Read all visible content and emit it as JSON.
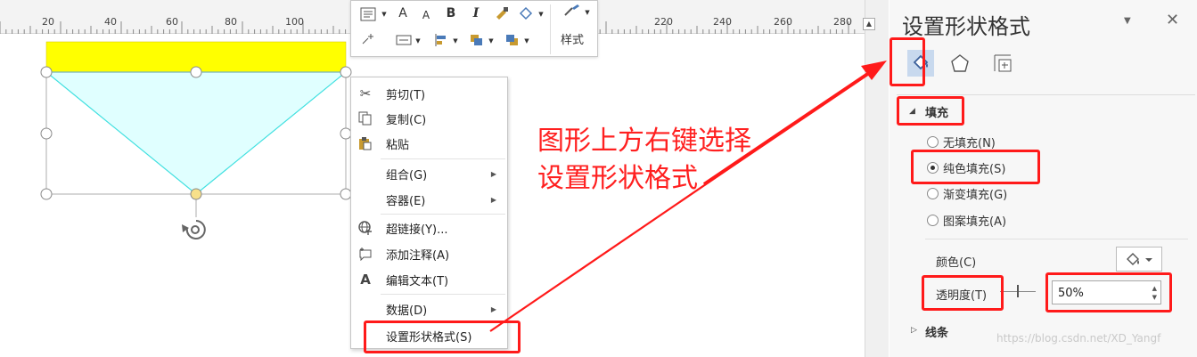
{
  "ruler": {
    "labels": [
      "20",
      "40",
      "60",
      "80",
      "100",
      "220",
      "240",
      "260",
      "280"
    ]
  },
  "mini_toolbar": {
    "bold": "B",
    "italic": "I",
    "grow_font": "A",
    "shrink_font": "A",
    "style_label": "样式"
  },
  "context_menu": {
    "items": [
      {
        "label": "剪切(T)",
        "icon": "scissors-icon"
      },
      {
        "label": "复制(C)",
        "icon": "copy-icon"
      },
      {
        "label": "粘贴",
        "icon": "paste-icon"
      },
      {
        "label": "组合(G)",
        "submenu": true
      },
      {
        "label": "容器(E)",
        "submenu": true
      },
      {
        "label": "超链接(Y)...",
        "icon": "hyperlink-icon"
      },
      {
        "label": "添加注释(A)",
        "icon": "comment-icon"
      },
      {
        "label": "编辑文本(T)",
        "icon": "edit-text-icon"
      },
      {
        "label": "数据(D)",
        "submenu": true
      },
      {
        "label": "设置形状格式(S)"
      }
    ]
  },
  "annotation": {
    "line1": "图形上方右键选择",
    "line2": "设置形状格式",
    "color": "#ff2020"
  },
  "format_pane": {
    "title": "设置形状格式",
    "fill_section": "填充",
    "fill_options": [
      {
        "label": "无填充(N)",
        "checked": false
      },
      {
        "label": "纯色填充(S)",
        "checked": true
      },
      {
        "label": "渐变填充(G)",
        "checked": false
      },
      {
        "label": "图案填充(A)",
        "checked": false
      }
    ],
    "color_label": "颜色(C)",
    "transparency_label": "透明度(T)",
    "transparency_value": "50%",
    "line_section": "线条"
  },
  "watermark": "https://blog.csdn.net/XD_Yangf",
  "colors": {
    "rect_fill": "#ffff00",
    "triangle_fill": "#e0ffff",
    "triangle_stroke": "#40e0e0",
    "handle_yellow": "#f7e08a",
    "highlight": "#ff1a1a"
  }
}
